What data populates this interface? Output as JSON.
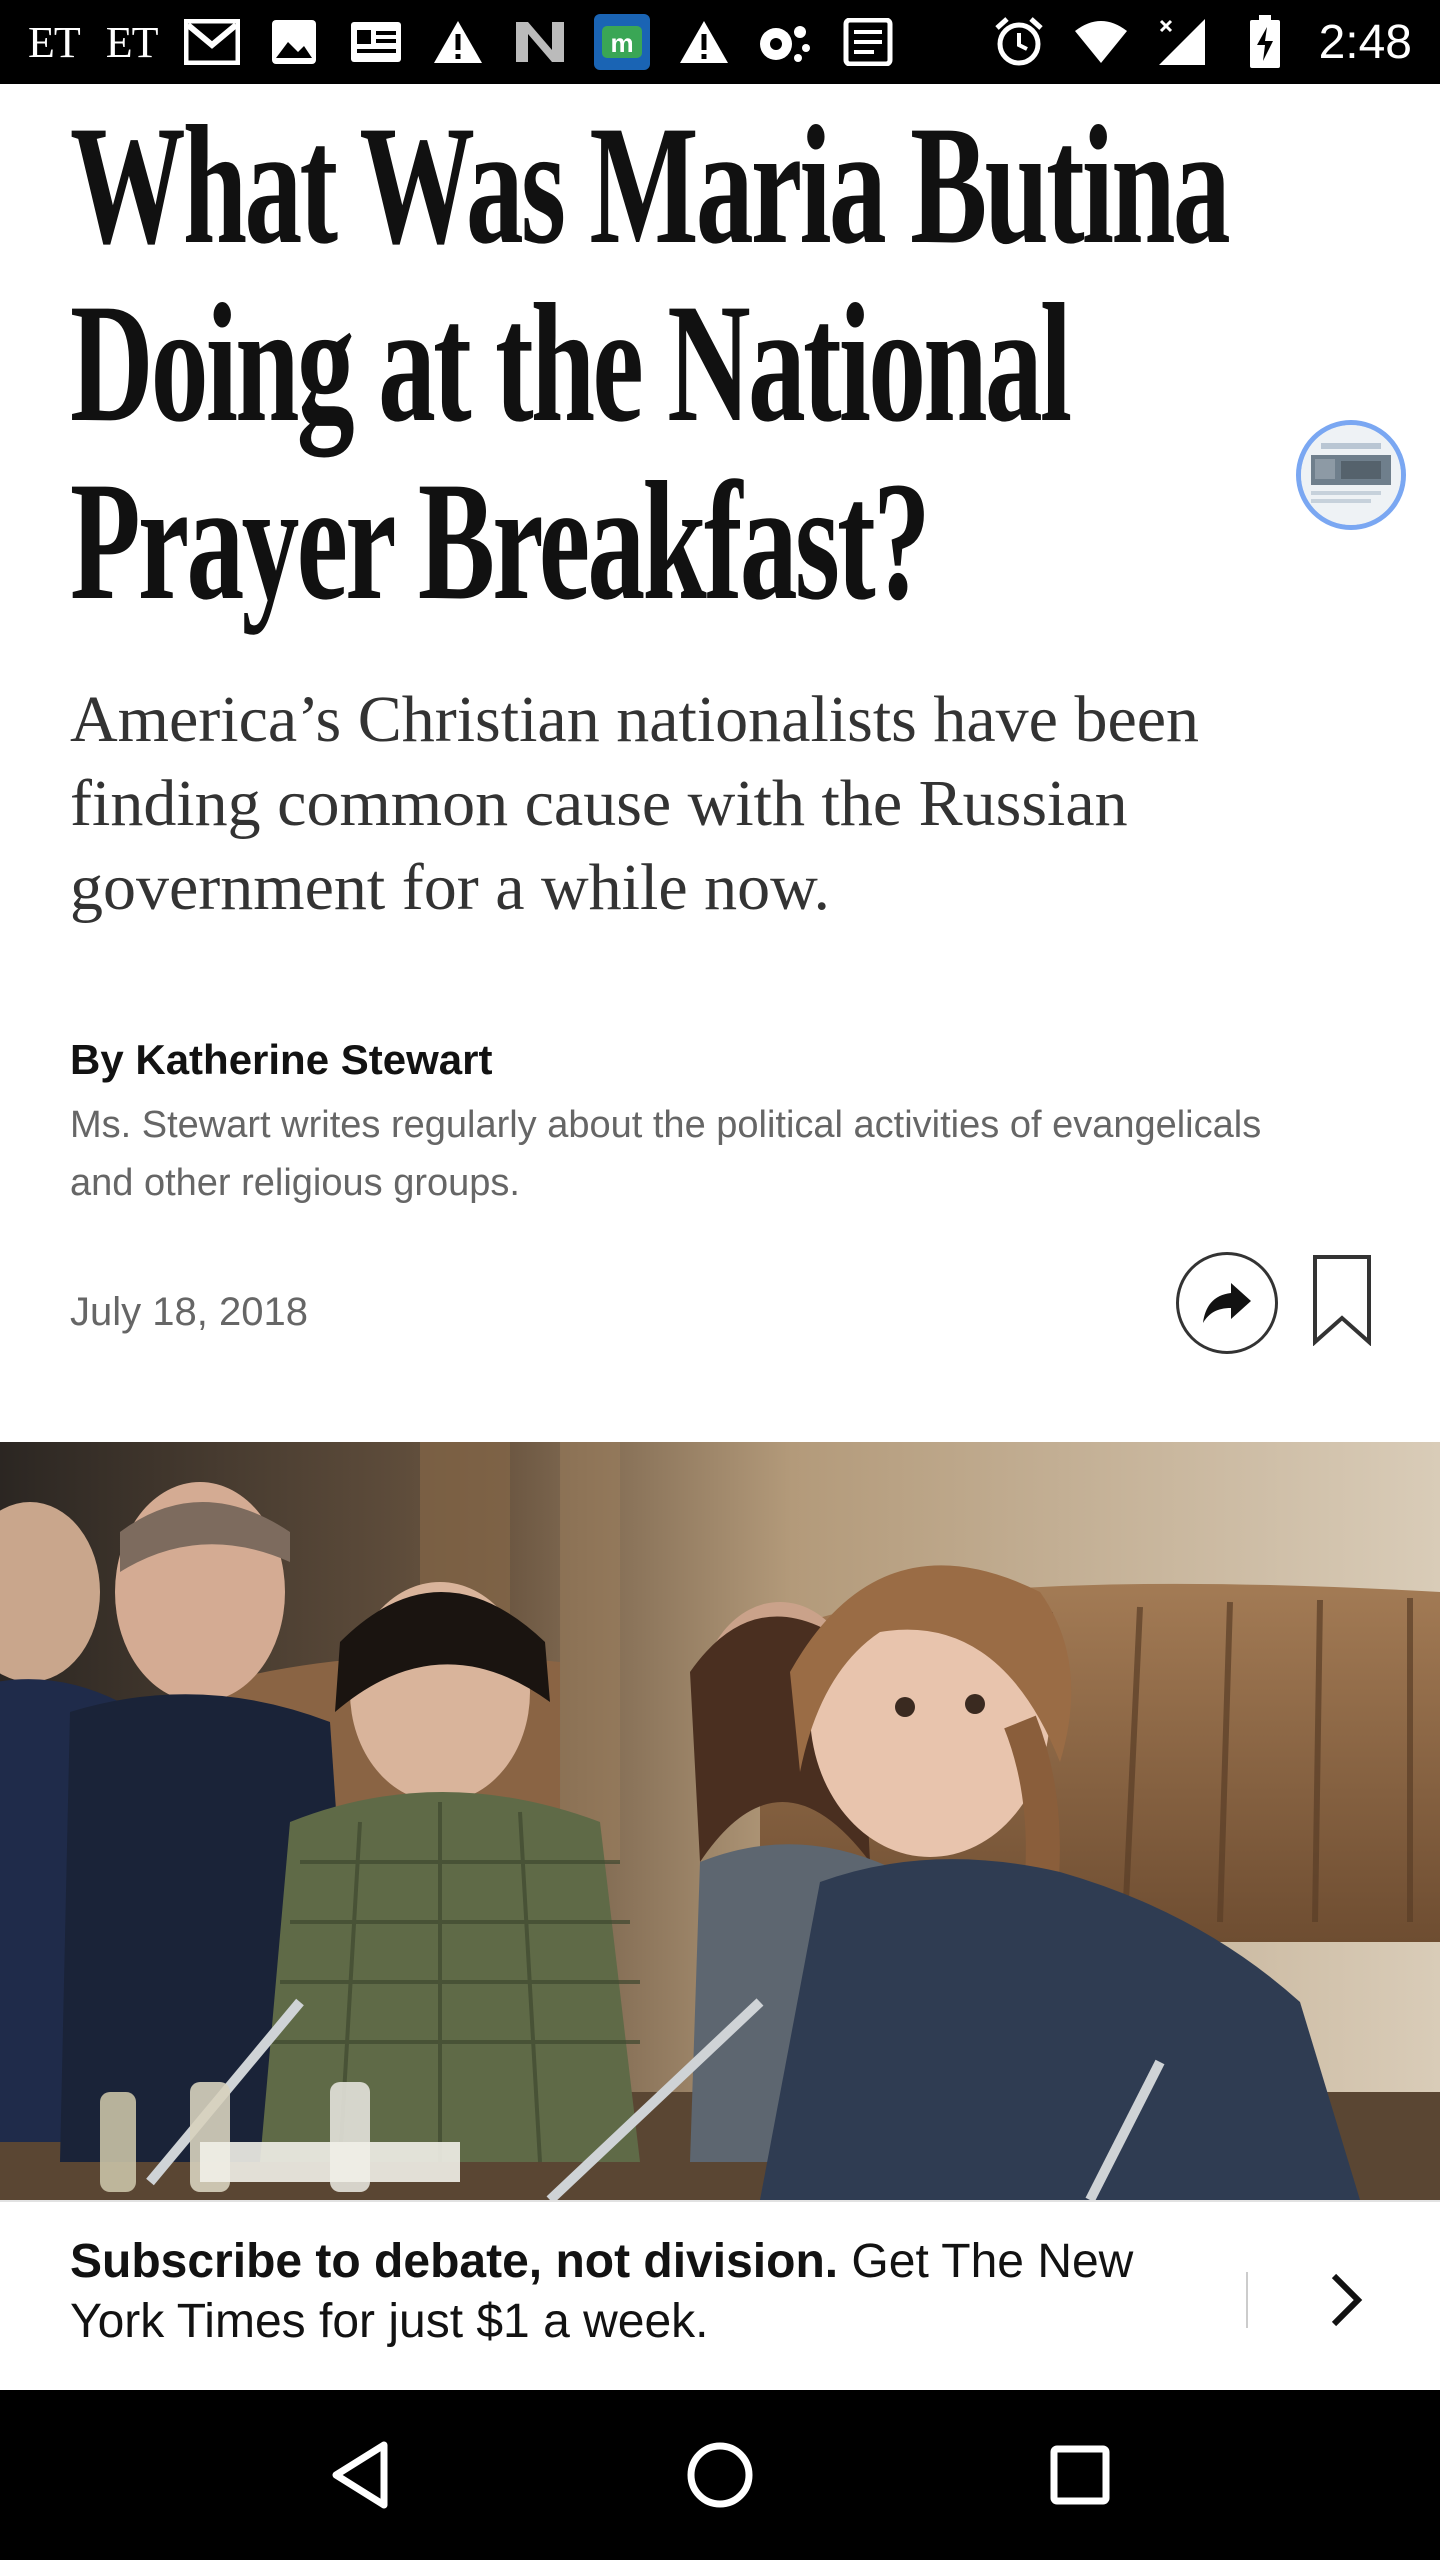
{
  "status_bar": {
    "left_texts": [
      "ET",
      "ET"
    ],
    "icons": [
      "gmail-icon",
      "photo-icon",
      "news-card-icon",
      "warning-icon",
      "n-app-icon",
      "m-app-icon",
      "warning-icon",
      "assistant-icon",
      "news-list-icon"
    ],
    "right_icons": [
      "alarm-icon",
      "wifi-icon",
      "signal-icon",
      "battery-charging-icon"
    ],
    "time": "2:48"
  },
  "article": {
    "headline": "What Was Maria Butina Doing at the National Prayer Breakfast?",
    "summary": "America’s Christian nationalists have been finding common cause with the Russian government for a while now.",
    "byline": "By Katherine Stewart",
    "author_bio": "Ms. Stewart writes regularly about the political activities of evangelicals and other religious groups.",
    "date": "July 18, 2018"
  },
  "subscribe_banner": {
    "bold_text": "Subscribe to debate, not division.",
    "text": " Get The New York Times for just $1 a week."
  },
  "colors": {
    "status_bar_bg": "#000000",
    "text_primary": "#121212",
    "text_secondary": "#666666",
    "bubble_border": "#7aa7f2"
  }
}
